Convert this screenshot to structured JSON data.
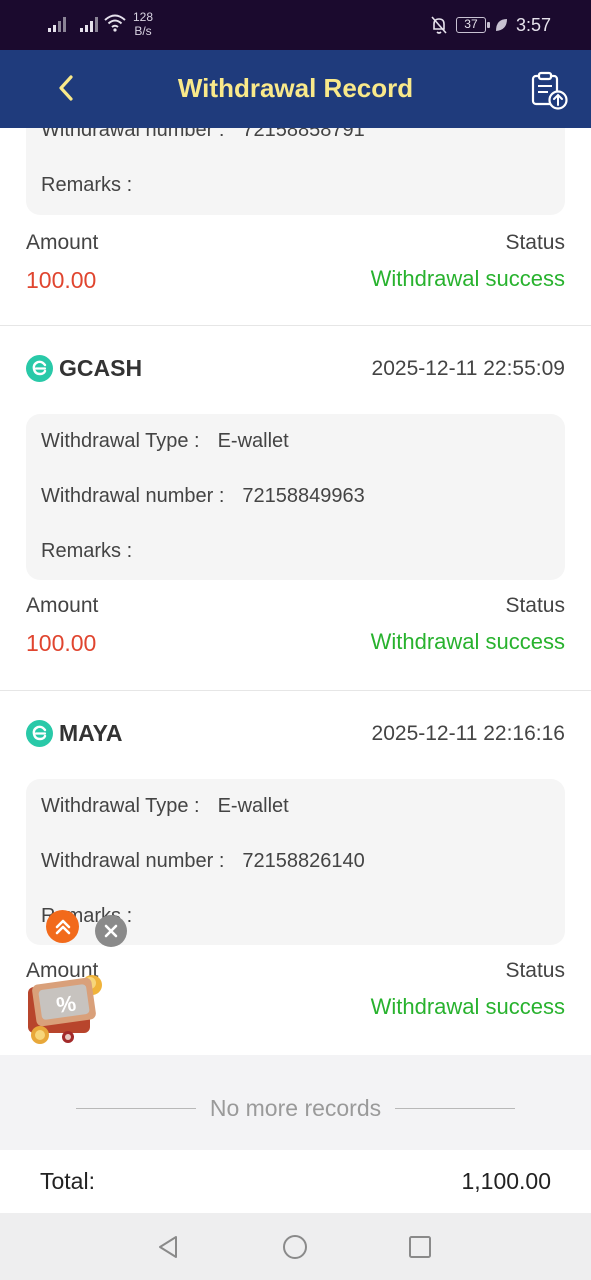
{
  "status_bar": {
    "speed_value": "128",
    "speed_unit": "B/s",
    "battery": "37",
    "time": "3:57"
  },
  "header": {
    "title": "Withdrawal Record"
  },
  "partial_record": {
    "number_label": "Withdrawal number :",
    "number_value": "72158858791",
    "remarks_label": "Remarks :",
    "remarks_value": "",
    "amount_label": "Amount",
    "amount_value": "100.00",
    "status_label": "Status",
    "status_value": "Withdrawal success"
  },
  "records": [
    {
      "method": "GCASH",
      "datetime": "2025-12-11 22:55:09",
      "type_label": "Withdrawal Type :",
      "type_value": "E-wallet",
      "number_label": "Withdrawal number :",
      "number_value": "72158849963",
      "remarks_label": "Remarks :",
      "remarks_value": "",
      "amount_label": "Amount",
      "amount_value": "100.00",
      "status_label": "Status",
      "status_value": "Withdrawal success"
    },
    {
      "method": "MAYA",
      "datetime": "2025-12-11 22:16:16",
      "type_label": "Withdrawal Type :",
      "type_value": "E-wallet",
      "number_label": "Withdrawal number :",
      "number_value": "72158826140",
      "remarks_label": "Remarks :",
      "remarks_value": "",
      "amount_label": "Amount",
      "amount_value": "",
      "status_label": "Status",
      "status_value": "Withdrawal success"
    }
  ],
  "footer": {
    "no_more": "No more records",
    "total_label": "Total:",
    "total_value": "1,100.00"
  },
  "colors": {
    "header_bg": "#1f3b7c",
    "title": "#f9e98a",
    "amount": "#e0452f",
    "status_success": "#28b22e",
    "wallet_logo": "#29c9a8"
  }
}
